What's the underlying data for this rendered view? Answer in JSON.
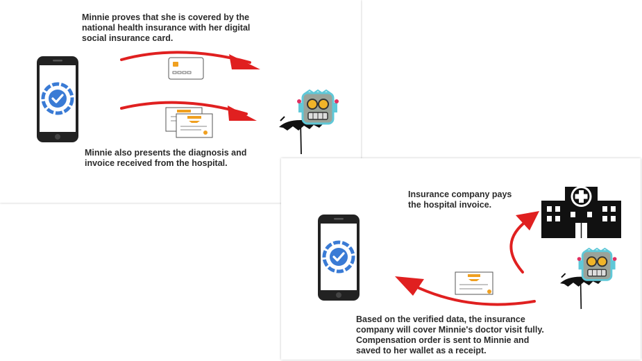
{
  "step1": {
    "caption_top": [
      "Minnie proves that she is covered by the",
      "national health insurance with her digital",
      "social insurance card."
    ],
    "caption_bottom": [
      "Minnie also presents the diagnosis and",
      "invoice received from the hospital."
    ]
  },
  "step2": {
    "caption_pays": [
      "Insurance company pays",
      "the hospital invoice."
    ],
    "caption_bottom": [
      "Based on the verified data, the insurance",
      "company will cover Minnie's doctor visit fully.",
      "Compensation order is sent to Minnie and",
      "saved to her wallet as a receipt."
    ]
  },
  "colors": {
    "arrow": "#e02020",
    "wallet_logo": "#3a7bd5",
    "phone_body": "#222222",
    "robot_face": "#9aa39a",
    "robot_outline": "#5fc8d8",
    "robot_eyes": "#f0b429",
    "document_accent": "#f0a020",
    "hospital": "#111111"
  },
  "icons": {
    "phone": "smartphone-with-wallet-app-icon",
    "card": "insurance-card-icon",
    "documents": "diagnosis-and-invoice-documents-icon",
    "insurer": "robot-with-umbrella-icon",
    "hospital": "hospital-building-icon"
  }
}
